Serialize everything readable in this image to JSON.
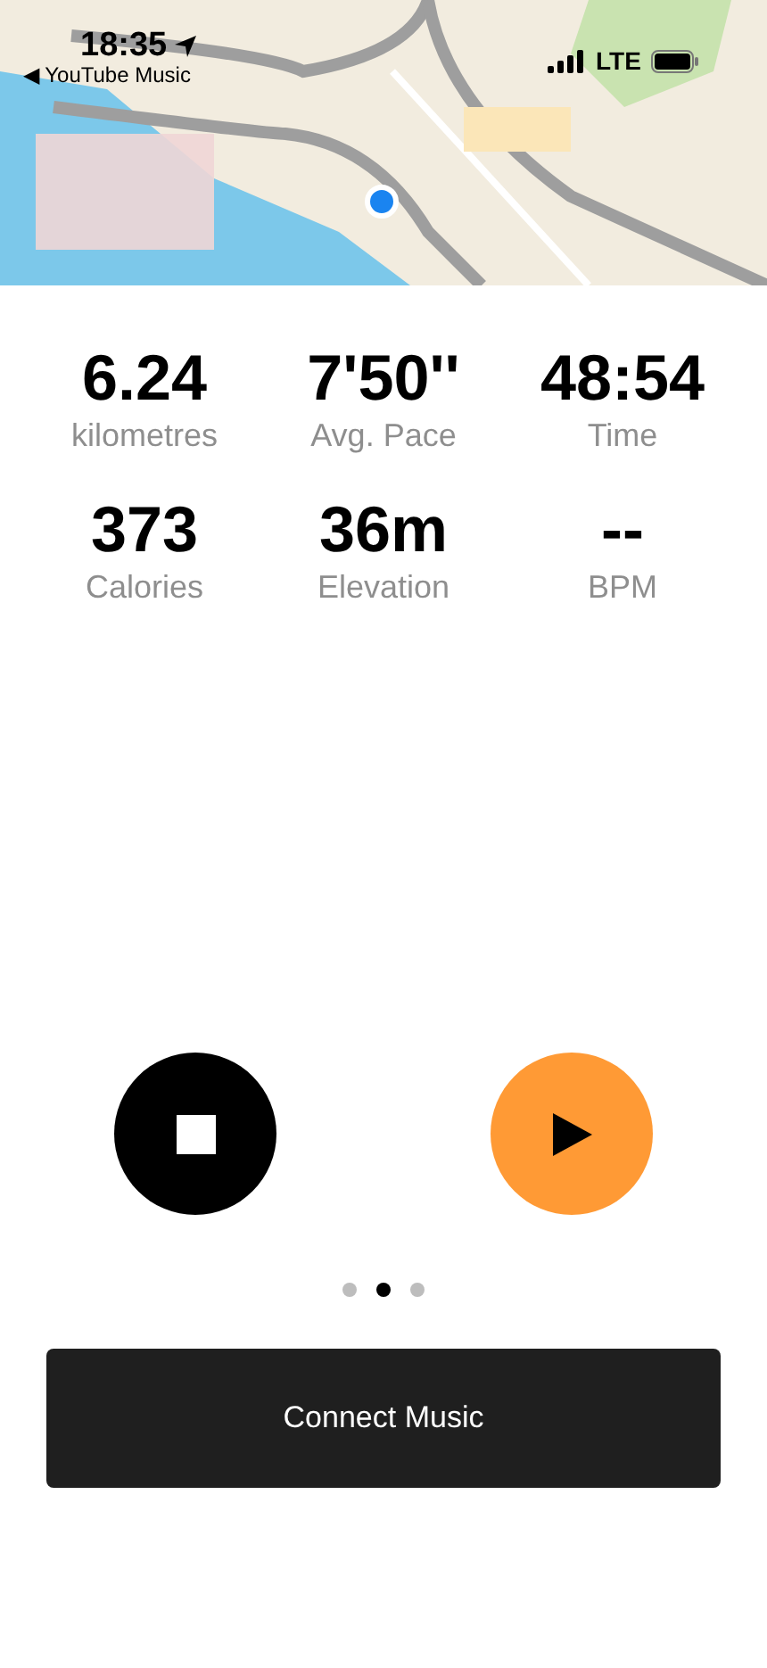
{
  "status_bar": {
    "time": "18:35",
    "back_link": "◀ YouTube Music",
    "network": "LTE"
  },
  "stats": [
    {
      "value": "6.24",
      "label": "kilometres"
    },
    {
      "value": "7'50''",
      "label": "Avg. Pace"
    },
    {
      "value": "48:54",
      "label": "Time"
    },
    {
      "value": "373",
      "label": "Calories"
    },
    {
      "value": "36m",
      "label": "Elevation"
    },
    {
      "value": "--",
      "label": "BPM"
    }
  ],
  "page_dots": [
    {
      "selected": false
    },
    {
      "selected": true
    },
    {
      "selected": false
    }
  ],
  "connect_button": {
    "label": "Connect Music"
  }
}
